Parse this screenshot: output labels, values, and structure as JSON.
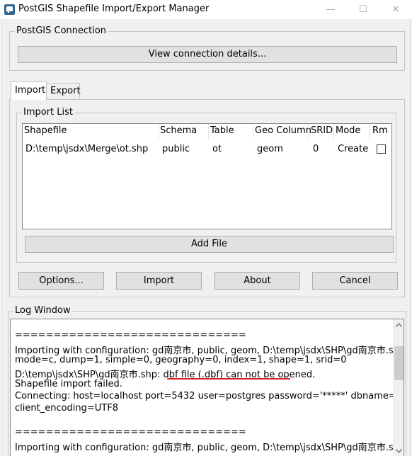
{
  "window": {
    "title": "PostGIS Shapefile Import/Export Manager",
    "minimize": "—",
    "maximize": "☐",
    "close": "✕"
  },
  "connection": {
    "group_label": "PostGIS Connection",
    "view_details_label": "View connection details..."
  },
  "tabs": [
    {
      "label": "Import",
      "active": true
    },
    {
      "label": "Export",
      "active": false
    }
  ],
  "import_list": {
    "group_label": "Import List",
    "columns": [
      "Shapefile",
      "Schema",
      "Table",
      "Geo Column",
      "SRID",
      "Mode",
      "Rm"
    ],
    "rows": [
      {
        "shapefile": "D:\\temp\\jsdx\\Merge\\ot.shp",
        "schema": "public",
        "table": "ot",
        "geo_column": "geom",
        "srid": "0",
        "mode": "Create",
        "rm": false
      }
    ],
    "add_file_label": "Add File"
  },
  "actions": {
    "options_label": "Options...",
    "import_label": "Import",
    "about_label": "About",
    "cancel_label": "Cancel"
  },
  "log": {
    "group_label": "Log Window",
    "lines": [
      "==============================",
      "Importing with configuration: gd南京市, public, geom, D:\\temp\\jsdx\\SHP\\gd南京市.shp,",
      "mode=c, dump=1, simple=0, geography=0, index=1, shape=1, srid=0",
      "D:\\temp\\jsdx\\SHP\\gd南京市.shp: dbf file (.dbf) can not be opened.",
      "Shapefile import failed.",
      "Connecting:  host=localhost port=5432 user=postgres password='*****' dbname=mydb",
      "client_encoding=UTF8",
      "",
      "==============================",
      "Importing with configuration: gd南京市, public, geom, D:\\temp\\jsdx\\SHP\\gd南京市.shp,"
    ]
  },
  "colors": {
    "highlight_underline": "#e02020"
  }
}
